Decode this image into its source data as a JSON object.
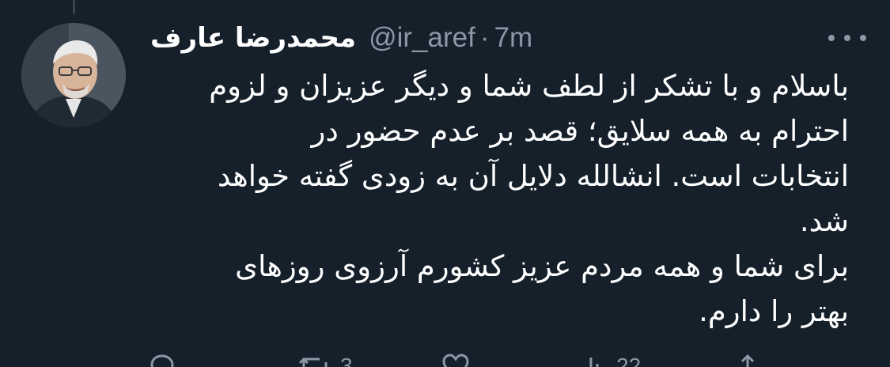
{
  "tweet": {
    "display_name": "محمدرضا عارف",
    "handle": "@ir_aref",
    "separator": "·",
    "time": "7m",
    "text_lines": [
      "باسلام و با تشکر از لطف شما و دیگر عزیزان و لزوم",
      "احترام به همه سلایق؛ قصد بر عدم حضور در",
      "انتخابات است. انشالله دلایل آن به زودی گفته خواهد",
      "شد.",
      " برای شما و همه مردم عزیز کشورم آرزوی روزهای",
      "بهتر را دارم."
    ]
  },
  "actions": {
    "reply_count": "",
    "retweet_count": "3",
    "like_count": "",
    "views_count": "22"
  },
  "colors": {
    "background": "#15202b",
    "text": "#ffffff",
    "secondary": "#8b98a5",
    "thread_line": "#38444d"
  },
  "icons": [
    "more-icon",
    "reply-icon",
    "retweet-icon",
    "like-icon",
    "views-icon",
    "share-icon"
  ]
}
